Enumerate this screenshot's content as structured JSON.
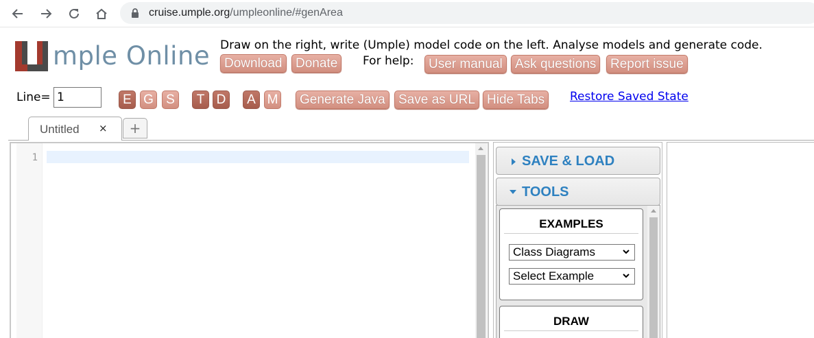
{
  "browser": {
    "url_host": "cruise.umple.org",
    "url_path": "/umpleonline/#genArea"
  },
  "header": {
    "logo_text": "mple Online",
    "tagline": "Draw on the right, write (Umple) model code on the left. Analyse models and generate code.",
    "help_label": "For help:",
    "download_label": "Download",
    "donate_label": "Donate",
    "user_manual_label": "User manual",
    "ask_questions_label": "Ask questions",
    "report_issue_label": "Report issue"
  },
  "toolbar": {
    "line_label": "Line=",
    "line_value": "1",
    "toggles": [
      "E",
      "G",
      "S",
      "T",
      "D",
      "A",
      "M"
    ],
    "generate_label": "Generate Java",
    "save_url_label": "Save as URL",
    "hide_tabs_label": "Hide Tabs",
    "restore_label": "Restore Saved State"
  },
  "tabs": {
    "active_label": "Untitled",
    "close_glyph": "×",
    "add_glyph": "+"
  },
  "editor": {
    "line_numbers": [
      "1"
    ]
  },
  "panel": {
    "save_load_label": "SAVE & LOAD",
    "tools_label": "TOOLS",
    "examples_title": "EXAMPLES",
    "diagram_select_value": "Class Diagrams",
    "example_select_value": "Select Example",
    "draw_title": "DRAW"
  },
  "colors": {
    "accent_blue": "#2e81c0",
    "button_pink": "#d28f80",
    "button_dark": "#a65c4c",
    "logo_gray": "#6f8fa6"
  }
}
